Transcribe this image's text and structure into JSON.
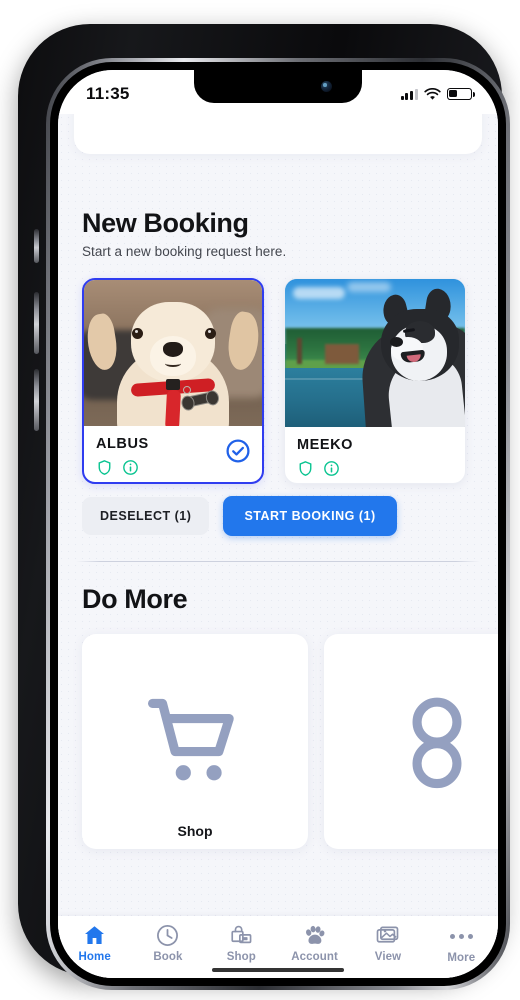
{
  "status_bar": {
    "time": "11:35",
    "signal_icon": "cellular-bars-icon",
    "wifi_icon": "wifi-icon",
    "battery_icon": "battery-icon"
  },
  "booking": {
    "title": "New Booking",
    "subtitle": "Start a new booking request here.",
    "pets": [
      {
        "name": "ALBUS",
        "selected": true,
        "shield_icon": "shield-icon",
        "info_icon": "info-icon",
        "check_icon": "check-circle-icon",
        "photo_alt": "tan puppy wearing red harness with bone tag"
      },
      {
        "name": "MEEKO",
        "selected": false,
        "shield_icon": "shield-icon",
        "info_icon": "info-icon",
        "photo_alt": "black and white husky by a lake"
      }
    ],
    "deselect_label": "DESELECT (1)",
    "start_label": "START BOOKING (1)"
  },
  "do_more": {
    "title": "Do More",
    "cards": [
      {
        "icon": "shopping-cart-icon",
        "label": "Shop"
      },
      {
        "icon": "circles-icon",
        "label": ""
      }
    ]
  },
  "tabbar": {
    "items": [
      {
        "label": "Home",
        "icon": "home-icon",
        "active": true
      },
      {
        "label": "Book",
        "icon": "clock-icon",
        "active": false
      },
      {
        "label": "Shop",
        "icon": "bag-icon",
        "active": false
      },
      {
        "label": "Account",
        "icon": "paw-icon",
        "active": false
      },
      {
        "label": "View",
        "icon": "image-icon",
        "active": false
      },
      {
        "label": "More",
        "icon": "ellipsis-icon",
        "active": false
      }
    ]
  },
  "colors": {
    "accent_blue": "#2277ec",
    "selection_border": "#2f3cf0",
    "verified_green": "#0bc491",
    "page_bg": "#f5f6fa",
    "tab_inactive": "#8c93ab"
  }
}
